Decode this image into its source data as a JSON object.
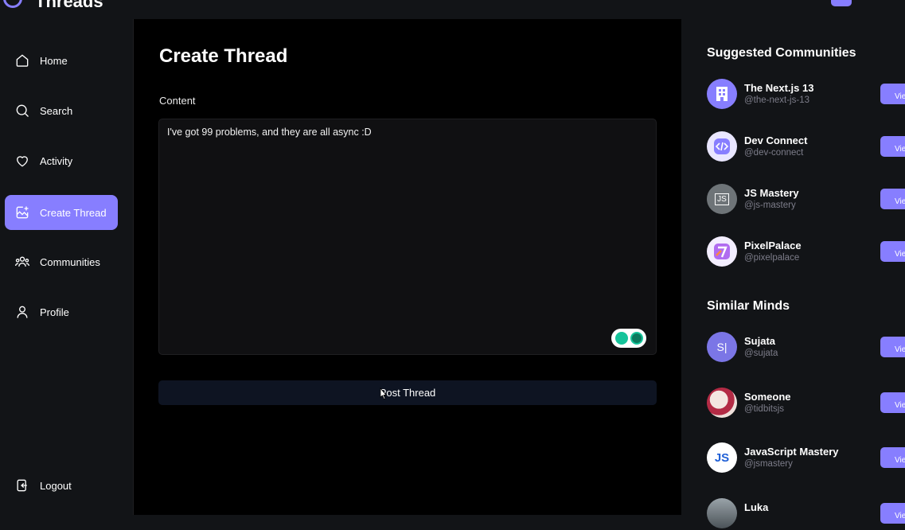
{
  "app": {
    "title": "Threads"
  },
  "sidebar": {
    "items": [
      {
        "label": "Home",
        "icon": "home-icon"
      },
      {
        "label": "Search",
        "icon": "search-icon"
      },
      {
        "label": "Activity",
        "icon": "heart-icon"
      },
      {
        "label": "Create Thread",
        "icon": "create-thread-icon",
        "active": true
      },
      {
        "label": "Communities",
        "icon": "communities-icon"
      },
      {
        "label": "Profile",
        "icon": "profile-icon"
      }
    ],
    "logout_label": "Logout"
  },
  "main": {
    "title": "Create Thread",
    "content_label": "Content",
    "content_value": "I've got 99 problems, and they are all async :D",
    "post_button": "Post Thread"
  },
  "right": {
    "suggested_title": "Suggested Communities",
    "communities": [
      {
        "name": "The Next.js 13",
        "handle": "@the-next-js-13",
        "button": "View"
      },
      {
        "name": "Dev Connect",
        "handle": "@dev-connect",
        "button": "View"
      },
      {
        "name": "JS Mastery",
        "handle": "@js-mastery",
        "button": "View"
      },
      {
        "name": "PixelPalace",
        "handle": "@pixelpalace",
        "button": "View"
      }
    ],
    "similar_title": "Similar Minds",
    "users": [
      {
        "name": "Sujata",
        "handle": "@sujata",
        "initials": "S|",
        "button": "View"
      },
      {
        "name": "Someone",
        "handle": "@tidbitsjs",
        "button": "View"
      },
      {
        "name": "JavaScript Mastery",
        "handle": "@jsmastery",
        "avatar_text": "JS",
        "button": "View"
      },
      {
        "name": "Luka",
        "handle": "",
        "button": "View"
      }
    ]
  },
  "colors": {
    "accent": "#877eff",
    "background": "#121417",
    "main": "#000000"
  }
}
